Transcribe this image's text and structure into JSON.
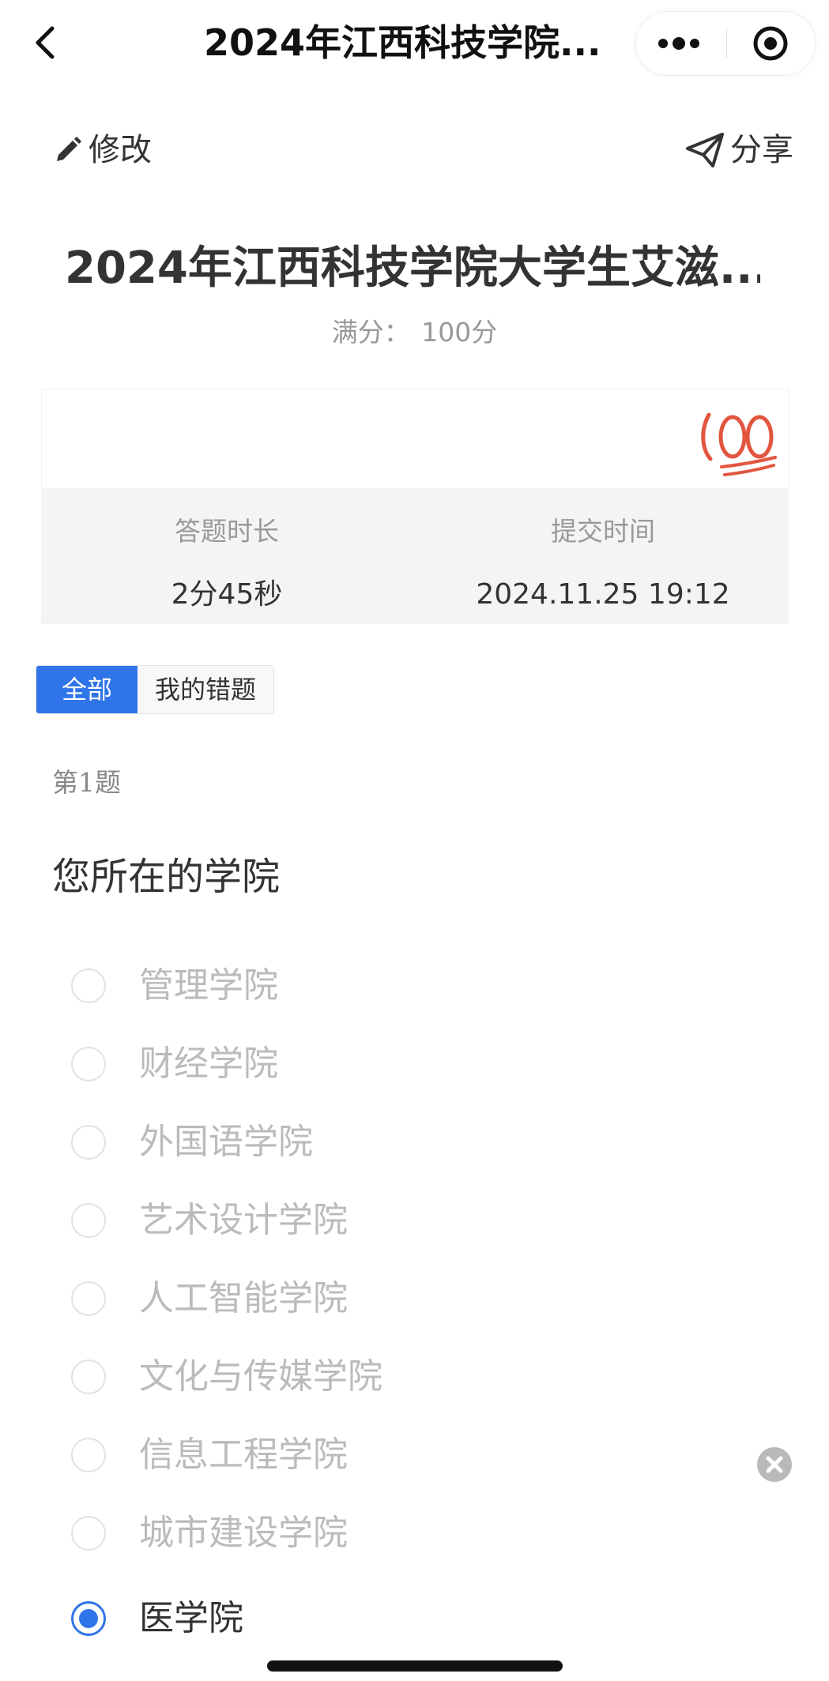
{
  "nav": {
    "title": "2024年江西科技学院...",
    "back_icon": "chevron-left-icon",
    "more_icon": "more-dots-icon",
    "target_icon": "target-icon"
  },
  "actions": {
    "edit_label": "修改",
    "share_label": "分享",
    "edit_icon": "pencil-icon",
    "share_icon": "send-icon"
  },
  "survey": {
    "title": "2024年江西科技学院大学生艾滋...",
    "score_label": "满分：",
    "score_value": "100分",
    "stamp_icon": "hundred-points-icon"
  },
  "stats": {
    "duration_label": "答题时长",
    "duration_value": "2分45秒",
    "submit_label": "提交时间",
    "submit_value": "2024.11.25 19:12"
  },
  "tabs": {
    "all_label": "全部",
    "wrong_label": "我的错题"
  },
  "question": {
    "number": "第1题",
    "text": "您所在的学院",
    "options": [
      {
        "label": "管理学院",
        "selected": false
      },
      {
        "label": "财经学院",
        "selected": false
      },
      {
        "label": "外国语学院",
        "selected": false
      },
      {
        "label": "艺术设计学院",
        "selected": false
      },
      {
        "label": "人工智能学院",
        "selected": false
      },
      {
        "label": "文化与传媒学院",
        "selected": false
      },
      {
        "label": "信息工程学院",
        "selected": false
      },
      {
        "label": "城市建设学院",
        "selected": false
      },
      {
        "label": "医学院",
        "selected": true
      }
    ]
  },
  "colors": {
    "accent": "#2f74e8",
    "muted_text": "#bbbbbb",
    "stats_bg": "#f4f4f6"
  }
}
